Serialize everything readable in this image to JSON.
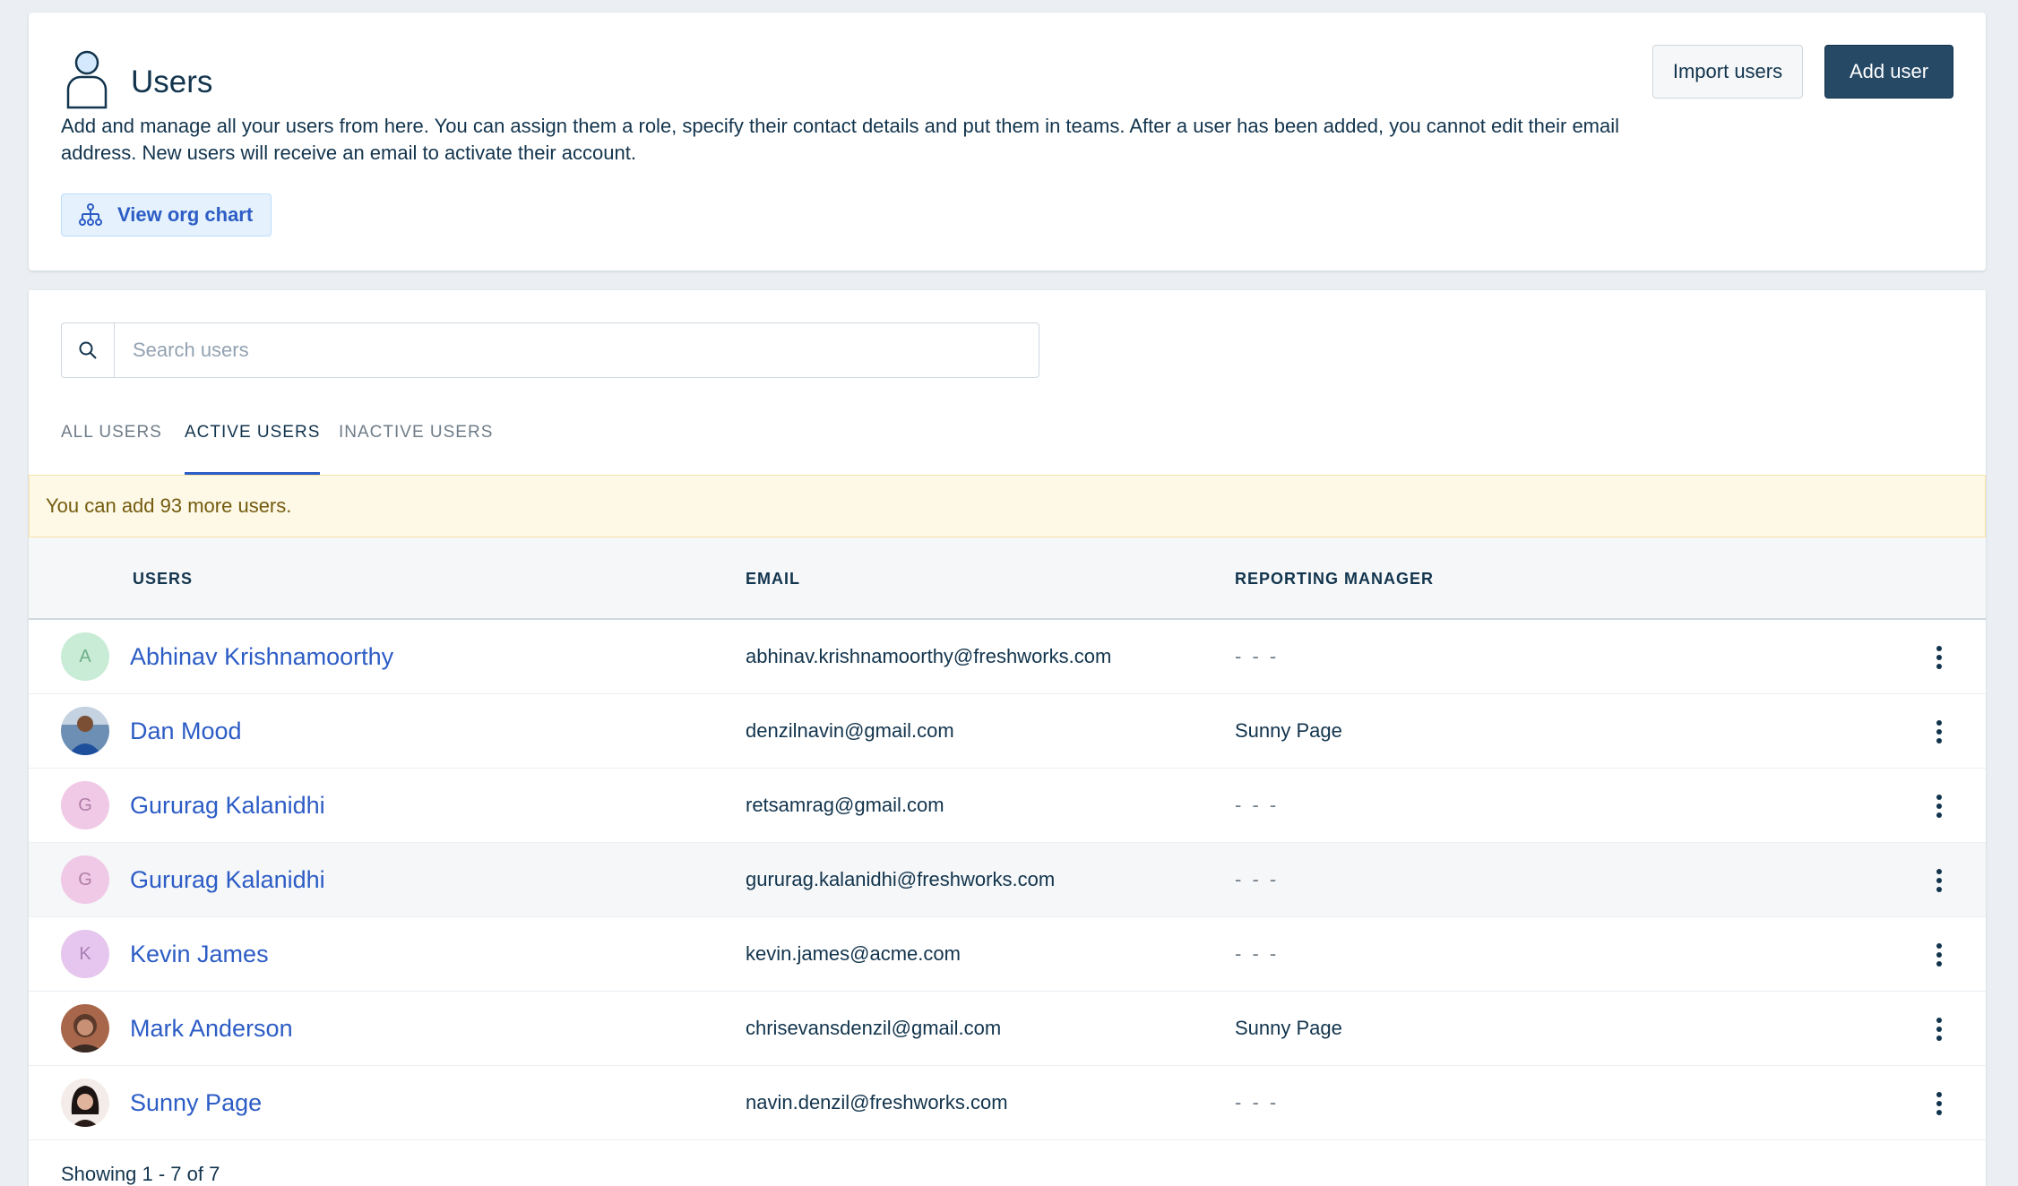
{
  "header": {
    "title": "Users",
    "description": "Add and manage all your users from here. You can assign them a role, specify their contact details and put them in teams. After a user has been added, you cannot edit their email address. New users will receive an email to activate their account.",
    "org_chart_label": "View org chart",
    "import_label": "Import users",
    "add_label": "Add user"
  },
  "search": {
    "placeholder": "Search users",
    "value": ""
  },
  "tabs": [
    {
      "label": "ALL USERS",
      "active": false
    },
    {
      "label": "ACTIVE USERS",
      "active": true
    },
    {
      "label": "INACTIVE USERS",
      "active": false
    }
  ],
  "notice": "You can add 93 more users.",
  "table": {
    "columns": [
      "USERS",
      "EMAIL",
      "REPORTING MANAGER"
    ],
    "rows": [
      {
        "initial": "A",
        "name": "Abhinav Krishnamoorthy",
        "email": "abhinav.krishnamoorthy@freshworks.com",
        "manager": "- - -"
      },
      {
        "initial": "",
        "name": "Dan Mood",
        "email": "denzilnavin@gmail.com",
        "manager": "Sunny Page"
      },
      {
        "initial": "G",
        "name": "Gururag Kalanidhi",
        "email": "retsamrag@gmail.com",
        "manager": "- - -"
      },
      {
        "initial": "G",
        "name": "Gururag Kalanidhi",
        "email": "gururag.kalanidhi@freshworks.com",
        "manager": "- - -"
      },
      {
        "initial": "K",
        "name": "Kevin James",
        "email": "kevin.james@acme.com",
        "manager": "- - -"
      },
      {
        "initial": "",
        "name": "Mark Anderson",
        "email": "chrisevansdenzil@gmail.com",
        "manager": "Sunny Page"
      },
      {
        "initial": "",
        "name": "Sunny Page",
        "email": "navin.denzil@freshworks.com",
        "manager": "- - -"
      }
    ]
  },
  "footer": {
    "showing": "Showing 1 - 7 of 7"
  },
  "colors": {
    "primary_dark": "#264966",
    "link": "#2c5cc5",
    "notice_bg": "#fef8e6"
  }
}
